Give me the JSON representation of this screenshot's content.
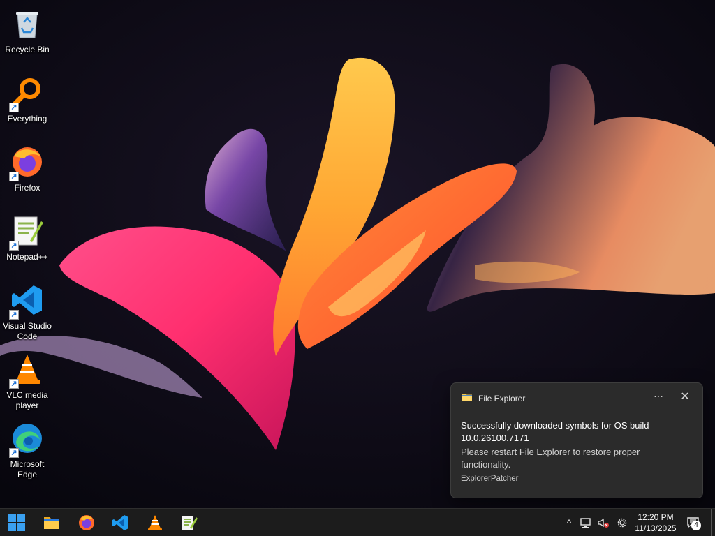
{
  "desktop": {
    "icons": [
      {
        "label": "Recycle Bin",
        "icon": "recycle-bin-icon",
        "shortcut": false
      },
      {
        "label": "Everything",
        "icon": "everything-search-icon",
        "shortcut": true
      },
      {
        "label": "Firefox",
        "icon": "firefox-icon",
        "shortcut": true
      },
      {
        "label": "Notepad++",
        "icon": "notepad-plus-plus-icon",
        "shortcut": true
      },
      {
        "label": "Visual Studio\nCode",
        "icon": "vscode-icon",
        "shortcut": true
      },
      {
        "label": "VLC media\nplayer",
        "icon": "vlc-icon",
        "shortcut": true
      },
      {
        "label": "Microsoft\nEdge",
        "icon": "edge-icon",
        "shortcut": true
      }
    ]
  },
  "toast": {
    "app_name": "File Explorer",
    "more_label": "···",
    "close_label": "✕",
    "title": "Successfully downloaded symbols for OS build 10.0.26100.7171",
    "body": "Please restart File Explorer to restore proper functionality.",
    "attribution": "ExplorerPatcher"
  },
  "taskbar": {
    "pinned": [
      "start-icon",
      "file-explorer-icon",
      "firefox-icon",
      "vscode-icon",
      "vlc-icon",
      "notepad-plus-plus-icon"
    ],
    "tray": {
      "chevron": "^",
      "icons": [
        "network-icon",
        "volume-muted-icon",
        "settings-gear-icon"
      ]
    },
    "clock": {
      "time": "12:20 PM",
      "date": "11/13/2025"
    },
    "notification_count": "4"
  },
  "colors": {
    "toast_bg": "#2b2b2b",
    "taskbar_bg": "#1c1c1c",
    "accent": "#1a6fd6"
  }
}
